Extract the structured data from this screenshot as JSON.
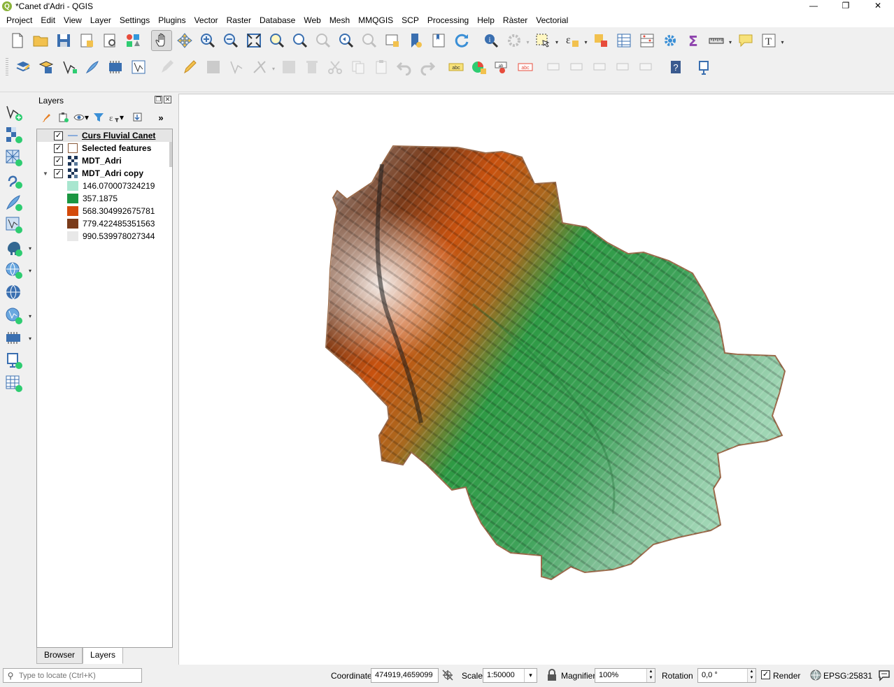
{
  "window": {
    "title": "*Canet d'Adri - QGIS",
    "app_icon_letter": "Q",
    "minimize": "—",
    "maximize": "❐",
    "close": "✕"
  },
  "menubar": {
    "items": [
      "Project",
      "Edit",
      "View",
      "Layer",
      "Settings",
      "Plugins",
      "Vector",
      "Raster",
      "Database",
      "Web",
      "Mesh",
      "MMQGIS",
      "SCP",
      "Processing",
      "Help",
      "Ràster",
      "Vectorial"
    ]
  },
  "layers_panel": {
    "title": "Layers",
    "more": "»",
    "layers": [
      {
        "name": "Curs Fluvial Canet",
        "checked": "✓"
      },
      {
        "name": "Selected features",
        "checked": "✓"
      },
      {
        "name": "MDT_Adri",
        "checked": "✓"
      },
      {
        "name": "MDT_Adri copy",
        "checked": "✓",
        "expander": "▼"
      }
    ],
    "legend": [
      {
        "label": "146.070007324219",
        "color": "#a8e6cf"
      },
      {
        "label": "357.1875",
        "color": "#1a9641"
      },
      {
        "label": "568.304992675781",
        "color": "#d44a0a"
      },
      {
        "label": "779.422485351563",
        "color": "#7a3b1a"
      },
      {
        "label": "990.539978027344",
        "color": "#e8e8e8"
      }
    ],
    "tabs": [
      "Browser",
      "Layers"
    ]
  },
  "statusbar": {
    "locator_placeholder": "Type to locate (Ctrl+K)",
    "coordinate_label": "Coordinate",
    "coordinate_value": "474919,4659099",
    "scale_label": "Scale",
    "scale_value": "1:50000",
    "magnifier_label": "Magnifier",
    "magnifier_value": "100%",
    "rotation_label": "Rotation",
    "rotation_value": "0,0 °",
    "render_label": "Render",
    "render_checked": "✓",
    "crs": "EPSG:25831"
  },
  "colors": {
    "low": "#9fd6b4",
    "mid": "#2e9a44",
    "high": "#c8520f",
    "peak": "#6e3a1e",
    "summit": "#e8e8e8"
  }
}
